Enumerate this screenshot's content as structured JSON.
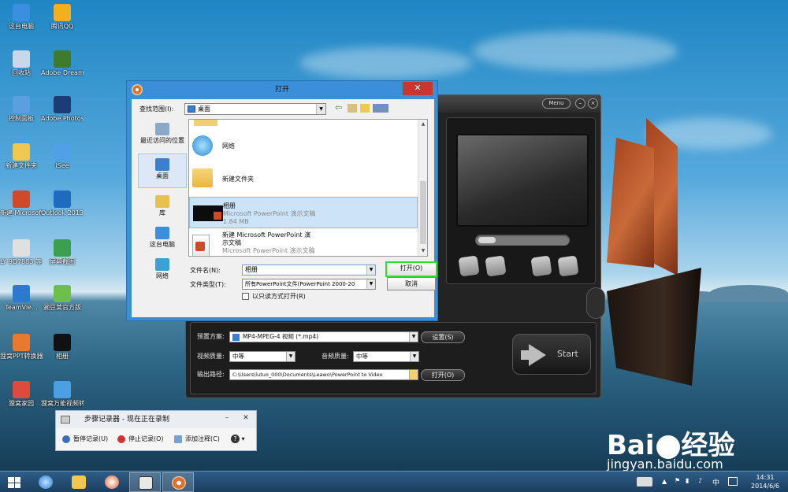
{
  "desktop": {
    "icons": [
      {
        "label": "这台电脑",
        "color": "#3a8fe0"
      },
      {
        "label": "腾讯QQ",
        "color": "#f0b020"
      },
      {
        "label": "回收站",
        "color": "#c8d8e8"
      },
      {
        "label": "Adobe Dreamwe...",
        "color": "#3e7b2e"
      },
      {
        "label": "控制面板",
        "color": "#5aa0e0"
      },
      {
        "label": "Adobe Photosh...",
        "color": "#1c3c78"
      },
      {
        "label": "新建文件夹",
        "color": "#f0c850"
      },
      {
        "label": "iSee",
        "color": "#50a0e8"
      },
      {
        "label": "新建 Microsoft...",
        "color": "#d04a2a"
      },
      {
        "label": "Outlook 2013",
        "color": "#1e6bbf"
      },
      {
        "label": "LY 9D7883 等..._副本",
        "color": "#e0e0e0"
      },
      {
        "label": "屏幕截图",
        "color": "#3aa050"
      },
      {
        "label": "TeamVie...",
        "color": "#2a7ad0"
      },
      {
        "label": "豌豆荚官方版",
        "color": "#6cc04a"
      },
      {
        "label": "狸窝PPT转换器",
        "color": "#e87a30"
      },
      {
        "label": "相册",
        "color": "#111111"
      },
      {
        "label": "狸窝家园",
        "color": "#e04a3a"
      },
      {
        "label": "狸窝万能视频转换",
        "color": "#4aa0e0"
      }
    ]
  },
  "watermark": {
    "brand": "Bai",
    "brand_cn": "经验",
    "url": "jingyan.baidu.com"
  },
  "app": {
    "menu_label": "Menu",
    "preset_label": "预置方案:",
    "preset_value": "MP4-MPEG-4 视频 (*.mp4)",
    "settings_btn": "设置(S)",
    "video_quality_label": "视频质量:",
    "video_quality_value": "中等",
    "audio_quality_label": "音频质量:",
    "audio_quality_value": "中等",
    "output_label": "输出路径:",
    "output_value": "C:\\Users\\lutuo_000\\Documents\\Leawo\\PowerPoint to Video",
    "open_btn": "打开(O)",
    "start_label": "Start"
  },
  "dialog": {
    "title": "打开",
    "close_glyph": "✕",
    "lookin_label": "查找范围(I):",
    "lookin_value": "桌面",
    "places": [
      {
        "label": "最近访问的位置",
        "color": "#8aa8c8"
      },
      {
        "label": "桌面",
        "color": "#3a7fd0"
      },
      {
        "label": "库",
        "color": "#e8c050"
      },
      {
        "label": "这台电脑",
        "color": "#3a8fe0"
      },
      {
        "label": "网络",
        "color": "#3aa0d8"
      }
    ],
    "files": [
      {
        "name": "网络",
        "sub1": "",
        "sub2": ""
      },
      {
        "name": "新建文件夹",
        "sub1": "",
        "sub2": ""
      },
      {
        "name": "相册",
        "sub1": "Microsoft PowerPoint 演示文稿",
        "sub2": "1.84 MB"
      },
      {
        "name": "新建 Microsoft PowerPoint 演",
        "sub1": "示文稿",
        "sub2": "Microsoft PowerPoint 演示文稿"
      }
    ],
    "filename_label": "文件名(N):",
    "filename_value": "相册",
    "filetype_label": "文件类型(T):",
    "filetype_value": "所有PowerPoint文件(PowerPoint 2000-20",
    "readonly_label": "以只读方式打开(R)",
    "open_btn": "打开(O)",
    "cancel_btn": "取消"
  },
  "steps_recorder": {
    "title": "步骤记录器 - 现在正在录制",
    "minimize": "–",
    "close": "✕",
    "pause": "暂停记录(U)",
    "stop": "停止记录(O)",
    "comment": "添加注释(C)",
    "help": "?"
  },
  "taskbar": {
    "ime": "中",
    "time": "14:31",
    "date": "2014/6/6"
  }
}
